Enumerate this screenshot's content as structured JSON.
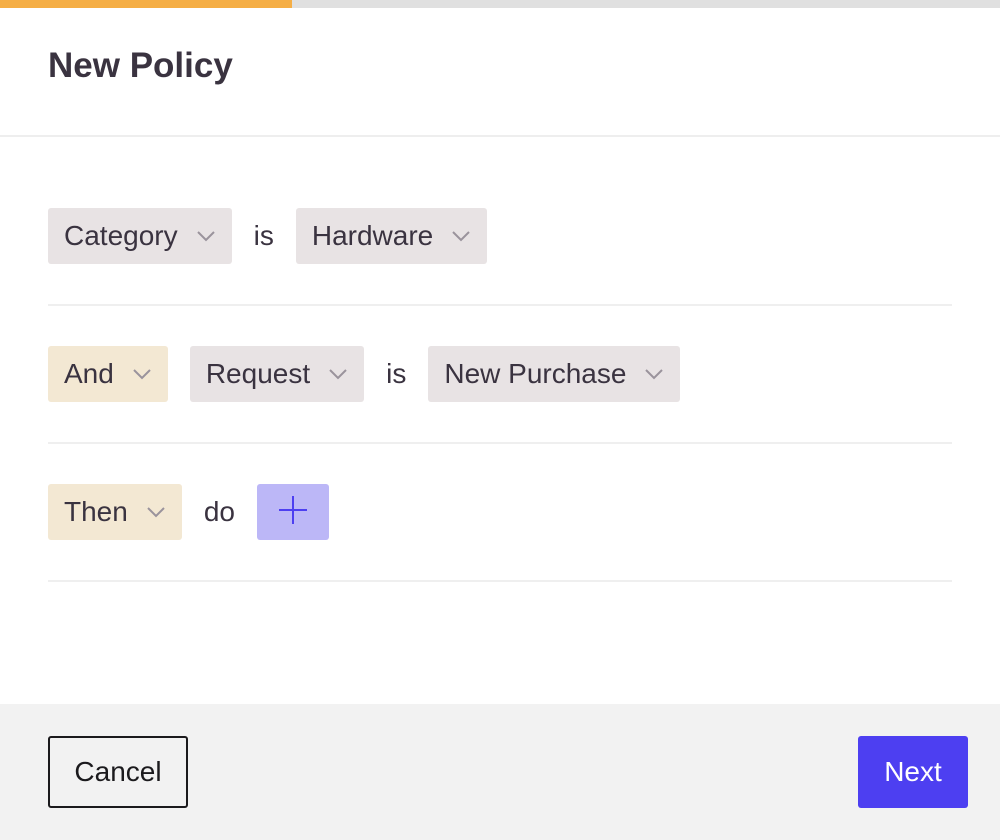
{
  "progress": {
    "fraction": 0.292,
    "fill_color": "#f5ae45",
    "track_color": "#e0e0e0"
  },
  "header": {
    "title": "New Policy"
  },
  "rules": {
    "row1": {
      "field": "Category",
      "connector": "is",
      "value": "Hardware"
    },
    "row2": {
      "logic": "And",
      "field": "Request",
      "connector": "is",
      "value": "New Purchase"
    },
    "row3": {
      "logic": "Then",
      "connector": "do",
      "add_icon": "plus-icon"
    }
  },
  "footer": {
    "cancel_label": "Cancel",
    "next_label": "Next"
  },
  "colors": {
    "accent": "#4d3ff1",
    "dropdown_grey": "#e8e3e4",
    "dropdown_cream": "#f3e8d3",
    "add_button": "#bcb7f7"
  },
  "icons": {
    "dropdown": "chevron-down-icon",
    "add": "plus-icon"
  }
}
